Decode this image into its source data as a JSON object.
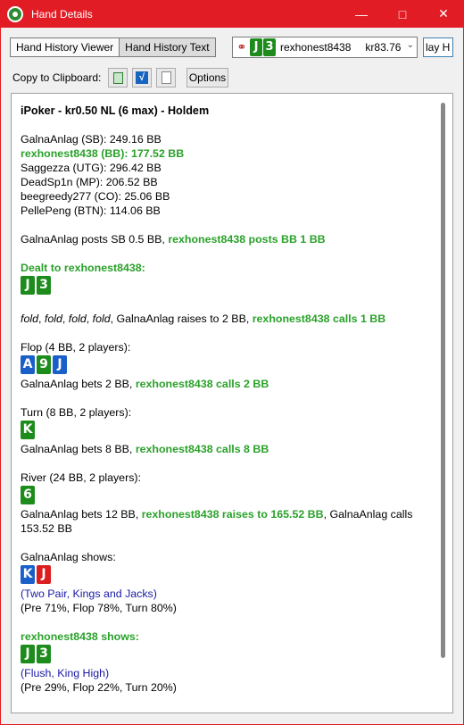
{
  "window": {
    "title": "Hand Details",
    "titlebar_color": "#e21c24",
    "minimize_icon": "minimize-icon",
    "maximize_icon": "maximize-icon",
    "close_icon": "close-icon"
  },
  "tabs": [
    {
      "label": "Hand History Viewer",
      "active": false
    },
    {
      "label": "Hand History Text",
      "active": true
    }
  ],
  "hand_selector": {
    "cards": [
      {
        "rank": "J",
        "suit_color": "green"
      },
      {
        "rank": "3",
        "suit_color": "green"
      }
    ],
    "player": "rexhonest8438",
    "amount": "kr83.76"
  },
  "replay_button": "lay H",
  "clipboard": {
    "label": "Copy to Clipboard:",
    "buttons": [
      "html-copy-icon",
      "chart-copy-icon",
      "text-copy-icon"
    ],
    "options_label": "Options"
  },
  "history": {
    "header": "iPoker - kr0.50 NL (6 max) - Holdem",
    "seats": [
      {
        "text": "GalnaAnlag (SB): 249.16 BB",
        "hero": false
      },
      {
        "text": "rexhonest8438 (BB): 177.52 BB",
        "hero": true
      },
      {
        "text": "Saggezza (UTG): 296.42 BB",
        "hero": false
      },
      {
        "text": "DeadSp1n (MP): 206.52 BB",
        "hero": false
      },
      {
        "text": "beegreedy277 (CO): 25.06 BB",
        "hero": false
      },
      {
        "text": "PellePeng (BTN): 114.06 BB",
        "hero": false
      }
    ],
    "blinds": {
      "sb": "GalnaAnlag posts SB 0.5 BB, ",
      "bb": "rexhonest8438 posts BB 1 BB"
    },
    "dealt": {
      "label": "Dealt to rexhonest8438:",
      "cards": [
        {
          "rank": "J",
          "color": "green"
        },
        {
          "rank": "3",
          "color": "green"
        }
      ]
    },
    "preflop": {
      "folds": [
        "fold",
        "fold",
        "fold",
        "fold"
      ],
      "raise": "GalnaAnlag raises to 2 BB, ",
      "hero_action": "rexhonest8438 calls 1 BB"
    },
    "flop": {
      "label": "Flop (4 BB, 2 players):",
      "cards": [
        {
          "rank": "A",
          "color": "blue"
        },
        {
          "rank": "9",
          "color": "green"
        },
        {
          "rank": "J",
          "color": "blue"
        }
      ],
      "action": "GalnaAnlag bets 2 BB, ",
      "hero_action": "rexhonest8438 calls 2 BB"
    },
    "turn": {
      "label": "Turn (8 BB, 2 players):",
      "cards": [
        {
          "rank": "K",
          "color": "green"
        }
      ],
      "action": "GalnaAnlag bets 8 BB, ",
      "hero_action": "rexhonest8438 calls 8 BB"
    },
    "river": {
      "label": "River (24 BB, 2 players):",
      "cards": [
        {
          "rank": "6",
          "color": "green"
        }
      ],
      "action": "GalnaAnlag bets 12 BB, ",
      "hero_action": "rexhonest8438 raises to 165.52 BB",
      "after": ", GalnaAnlag calls 153.52 BB"
    },
    "villain_show": {
      "label": "GalnaAnlag shows:",
      "cards": [
        {
          "rank": "K",
          "color": "blue"
        },
        {
          "rank": "J",
          "color": "red"
        }
      ],
      "desc": "(Two Pair, Kings and Jacks)",
      "equity": "(Pre 71%, Flop 78%, Turn 80%)"
    },
    "hero_show": {
      "label": "rexhonest8438 shows:",
      "cards": [
        {
          "rank": "J",
          "color": "green"
        },
        {
          "rank": "3",
          "color": "green"
        }
      ],
      "desc": "(Flush, King High)",
      "equity": "(Pre 29%, Flop 22%, Turn 20%)"
    }
  },
  "colors": {
    "hero_text": "#2aa12a",
    "hand_desc_text": "#1a1aa6",
    "card_green": "#1d8c1d",
    "card_blue": "#1a5fc8",
    "card_red": "#dc1e1e"
  }
}
